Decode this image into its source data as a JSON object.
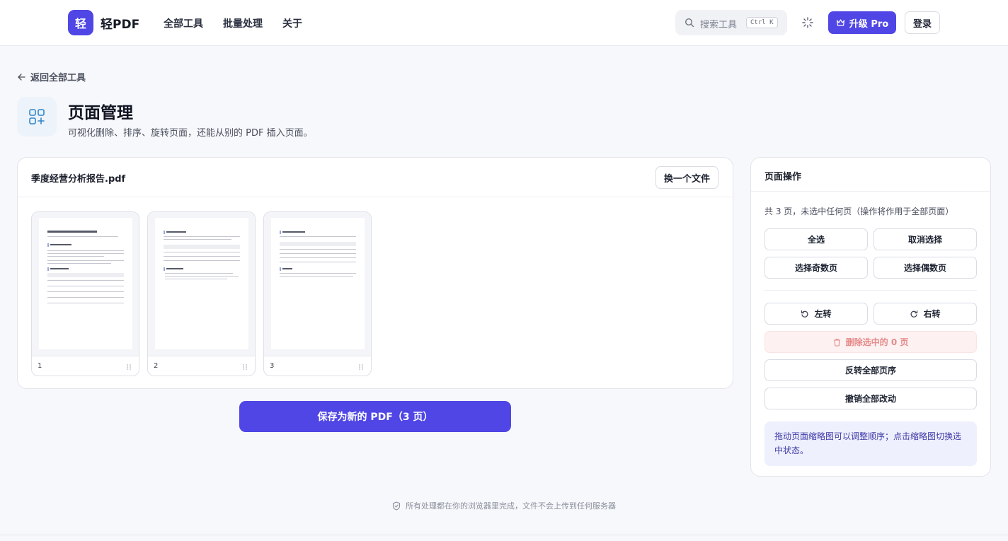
{
  "header": {
    "logo_char": "轻",
    "logo_text": "轻PDF",
    "nav": [
      "全部工具",
      "批量处理",
      "关于"
    ],
    "search_placeholder": "搜索工具",
    "search_shortcut": "Ctrl K",
    "upgrade_label": "升级 Pro",
    "login_label": "登录"
  },
  "back_link": "返回全部工具",
  "page": {
    "title": "页面管理",
    "description": "可视化删除、排序、旋转页面，还能从别的 PDF 插入页面。"
  },
  "file": {
    "name": "季度经营分析报告.pdf",
    "swap_label": "换一个文件"
  },
  "thumbnails": [
    {
      "number": "1"
    },
    {
      "number": "2"
    },
    {
      "number": "3"
    }
  ],
  "save_label": "保存为新的 PDF（3 页）",
  "panel": {
    "title": "页面操作",
    "info": "共 3 页，未选中任何页（操作将作用于全部页面）",
    "select_all": "全选",
    "deselect": "取消选择",
    "select_odd": "选择奇数页",
    "select_even": "选择偶数页",
    "rotate_left": "左转",
    "rotate_right": "右转",
    "delete_selected": "删除选中的 0 页",
    "reverse_order": "反转全部页序",
    "undo_all": "撤销全部改动",
    "hint": "拖动页面缩略图可以调整顺序；点击缩略图切换选中状态。"
  },
  "footer": "所有处理都在你的浏览器里完成，文件不会上传到任何服务器",
  "colors": {
    "accent": "#4f46e5",
    "danger_bg": "#fdf1f1",
    "danger_text": "#e58a8a",
    "hint_bg": "#eef0fd"
  }
}
